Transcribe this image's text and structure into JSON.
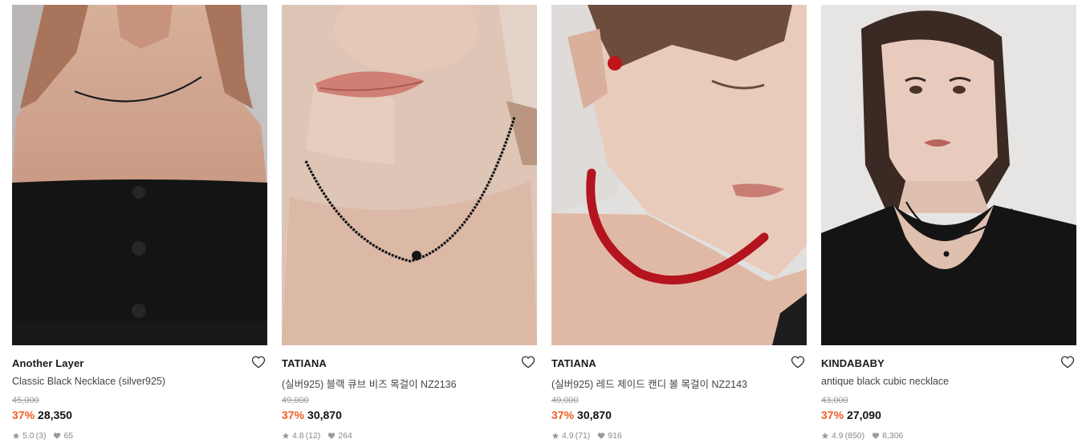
{
  "products": [
    {
      "brand": "Another Layer",
      "name": "Classic Black Necklace (silver925)",
      "original_price": "45,000",
      "discount": "37%",
      "price": "28,350",
      "rating": "5.0",
      "review_count": "(3)",
      "likes": "65"
    },
    {
      "brand": "TATIANA",
      "name": "(실버925) 블랙 큐브 비즈 목걸이 NZ2136",
      "original_price": "49,000",
      "discount": "37%",
      "price": "30,870",
      "rating": "4.8",
      "review_count": "(12)",
      "likes": "264"
    },
    {
      "brand": "TATIANA",
      "name": "(실버925) 레드 제이드 캔디 볼 목걸이 NZ2143",
      "original_price": "49,000",
      "discount": "37%",
      "price": "30,870",
      "rating": "4.9",
      "review_count": "(71)",
      "likes": "916"
    },
    {
      "brand": "KINDABABY",
      "name": "antique black cubic necklace",
      "original_price": "43,000",
      "discount": "37%",
      "price": "27,090",
      "rating": "4.9",
      "review_count": "(850)",
      "likes": "8,306"
    }
  ],
  "colors": {
    "discount": "#f15c22",
    "meta": "#8a8a8a",
    "original_price": "#9a9a9a"
  },
  "icons": {
    "wishlist": "heart-outline-icon",
    "rating": "star-icon",
    "likes": "heart-filled-icon"
  }
}
